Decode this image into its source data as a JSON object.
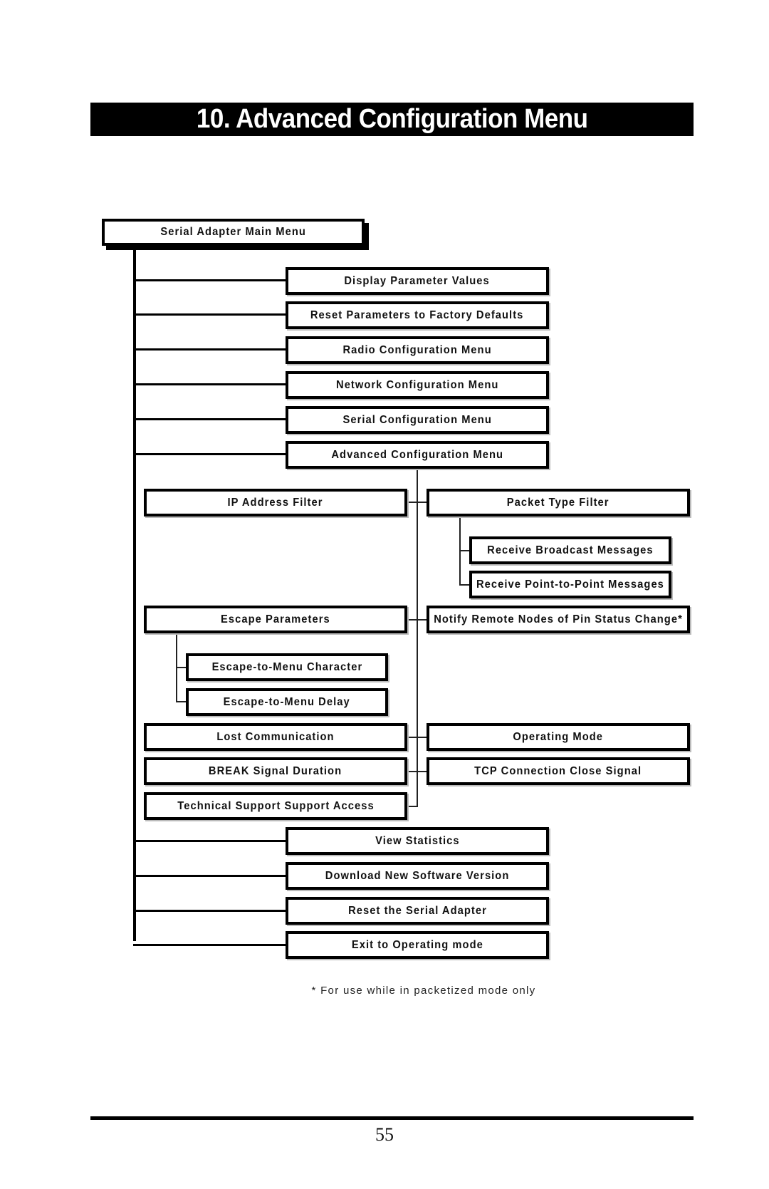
{
  "page": {
    "heading": "10. Advanced Configuration Menu",
    "footnote": "* For use while in packetized mode only",
    "page_number": "55"
  },
  "menu_tree": {
    "root": "Serial Adapter Main Menu",
    "main_items": [
      "Display Parameter Values",
      "Reset Parameters to Factory Defaults",
      "Radio Configuration Menu",
      "Network Configuration Menu",
      "Serial Configuration Menu",
      "Advanced Configuration Menu",
      "View Statistics",
      "Download New Software Version",
      "Reset the Serial Adapter",
      "Exit to Operating mode"
    ],
    "advanced": {
      "left": [
        "IP Address Filter",
        "Escape Parameters",
        "Lost Communication",
        "BREAK Signal Duration",
        "Technical Support Support Access"
      ],
      "right": [
        "Packet Type Filter",
        "Notify Remote Nodes of Pin Status Change*",
        "Operating Mode",
        "TCP Connection Close Signal"
      ],
      "escape_children": [
        "Escape-to-Menu Character",
        "Escape-to-Menu Delay"
      ],
      "packet_type_children": [
        "Receive Broadcast Messages",
        "Receive Point-to-Point Messages"
      ]
    }
  }
}
